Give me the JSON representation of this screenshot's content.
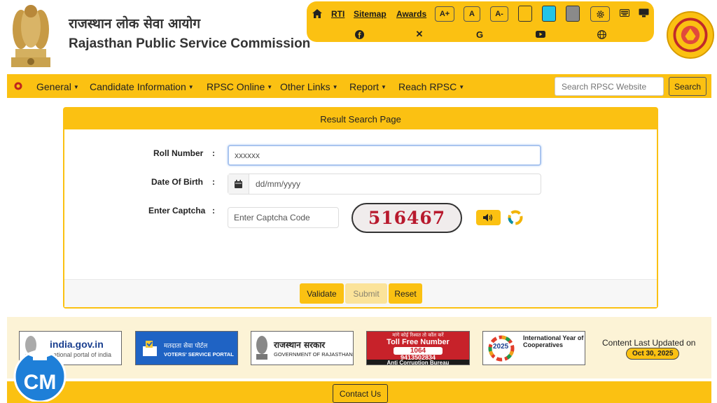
{
  "header": {
    "title_hindi": "राजस्थान लोक सेवा आयोग",
    "title_english": "Rajasthan Public Service Commission"
  },
  "utility": {
    "links": [
      "RTI",
      "Sitemap",
      "Awards"
    ],
    "font_buttons": [
      "A+",
      "A",
      "A-"
    ],
    "theme_colors": [
      "#fbc112",
      "#22c4e6",
      "#8a8a8a"
    ]
  },
  "nav": {
    "items": [
      "General",
      "Candidate Information",
      "RPSC Online",
      "Other Links",
      "Report",
      "Reach RPSC"
    ],
    "search_placeholder": "Search RPSC Website",
    "search_button": "Search"
  },
  "form": {
    "title": "Result Search Page",
    "roll_label": "Roll Number",
    "roll_value": "xxxxxx",
    "dob_label": "Date Of Birth",
    "dob_placeholder": "dd/mm/yyyy",
    "captcha_label": "Enter Captcha",
    "captcha_placeholder": "Enter Captcha Code",
    "captcha_text": "516467",
    "colon": ":",
    "buttons": {
      "validate": "Validate",
      "submit": "Submit",
      "reset": "Reset"
    }
  },
  "footer": {
    "logos": {
      "india_gov": "india.gov.in",
      "india_gov_sub": "national portal of india",
      "voters_hi": "मतदाता सेवा पोर्टल",
      "voters_en": "VOTERS' SERVICE PORTAL",
      "raj_hi": "राजस्थान सरकार",
      "raj_en": "GOVERNMENT OF RAJASTHAN",
      "acb_top": "मांगे कोई रिश्वत तो कॉल करें",
      "acb_title": "Toll Free Number",
      "acb_num1": "1064",
      "acb_num2": "9413502834",
      "acb_name": "Anti Corruption Bureau",
      "coop_title": "International Year of Cooperatives",
      "coop_year": "2025"
    },
    "updated_label": "Content Last Updated on",
    "updated_date": "Oct 30, 2025",
    "contact": "Contact Us"
  },
  "watermark": {
    "text": "CM"
  }
}
